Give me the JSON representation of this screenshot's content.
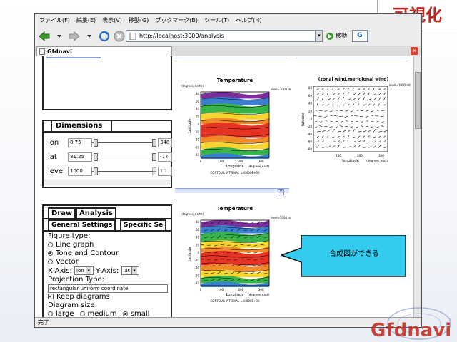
{
  "slide": {
    "title": "可視化"
  },
  "browser": {
    "menu": [
      "ファイル(F)",
      "編集(E)",
      "表示(V)",
      "移動(G)",
      "ブックマーク(B)",
      "ツール(T)",
      "ヘルプ(H)"
    ],
    "url": "http://localhost:3000/analysis",
    "go_label": "移動",
    "search_glyph": "G",
    "tab_title": "Gfdnavi",
    "status": "完了"
  },
  "dimensions": {
    "title": "Dimensions",
    "rows": [
      {
        "label": "lon",
        "value": "8.75",
        "max": "348",
        "slider": 0.025
      },
      {
        "label": "lat",
        "value": "81.25",
        "max": "-77",
        "slider": 1.0
      },
      {
        "label": "level",
        "value": "1000",
        "max": "10",
        "slider": 1.0
      }
    ]
  },
  "draw_panel": {
    "tabs": [
      "Draw",
      "Analysis"
    ],
    "subtabs": [
      "General Settings",
      "Specific Se"
    ],
    "figure_type_label": "Figure type:",
    "figure_types": [
      {
        "label": "Line graph",
        "selected": false
      },
      {
        "label": "Tone and Contour",
        "selected": true
      },
      {
        "label": "Vector",
        "selected": false
      }
    ],
    "xaxis_label": "X-Axis:",
    "xaxis_value": "lon",
    "yaxis_label": "Y-Axis:",
    "yaxis_value": "lat",
    "projection_label": "Projection Type:",
    "projection_value": "rectangular uniform coordinate",
    "keep_diagrams": "Keep diagrams",
    "diagram_size_label": "Diagram size:",
    "sizes": [
      {
        "label": "large",
        "selected": false
      },
      {
        "label": "medium",
        "selected": false
      },
      {
        "label": "small",
        "selected": true
      }
    ]
  },
  "plots": {
    "temp1": {
      "title": "Temperature",
      "subtitle": "(degrees_north)",
      "level": "level=1000 mb",
      "ylabel": "Latitude",
      "xlabel": "Longitude",
      "xunit": "(degrees_east)",
      "footer": "CONTOUR INTERVAL = 6.000E+00",
      "yticks": [
        "80",
        "60",
        "40",
        "20",
        "0",
        "-20",
        "-40",
        "-60",
        "-80"
      ],
      "xticks": [
        "0",
        "100",
        "200",
        "300"
      ]
    },
    "wind": {
      "title": "(zonal wind,meridional wind)",
      "level": "level=1000 mb",
      "ylabel": "latitude",
      "xlabel": "longitude",
      "xunit": "(degrees_east)",
      "yticks": [
        "80",
        "60",
        "40",
        "20",
        "0",
        "-20",
        "-40",
        "-60",
        "-80"
      ],
      "xticks": [
        "100",
        "200",
        "300"
      ]
    },
    "temp2": {
      "title": "Temperature",
      "subtitle": "(degrees_north)",
      "level": "level=1000 mb",
      "ylabel": "Latitude",
      "xlabel": "Longitude",
      "xunit": "(degrees_east)",
      "footer": "CONTOUR INTERVAL = 6.000E+00",
      "yticks": [
        "80",
        "60",
        "40",
        "20",
        "0",
        "-20",
        "-40",
        "-60",
        "-80"
      ],
      "xticks": [
        "0",
        "100",
        "200",
        "300"
      ]
    }
  },
  "callout": {
    "text": "合成図ができる",
    "fill": "#33ccee"
  },
  "logo": {
    "text": "Gfdnavi"
  }
}
